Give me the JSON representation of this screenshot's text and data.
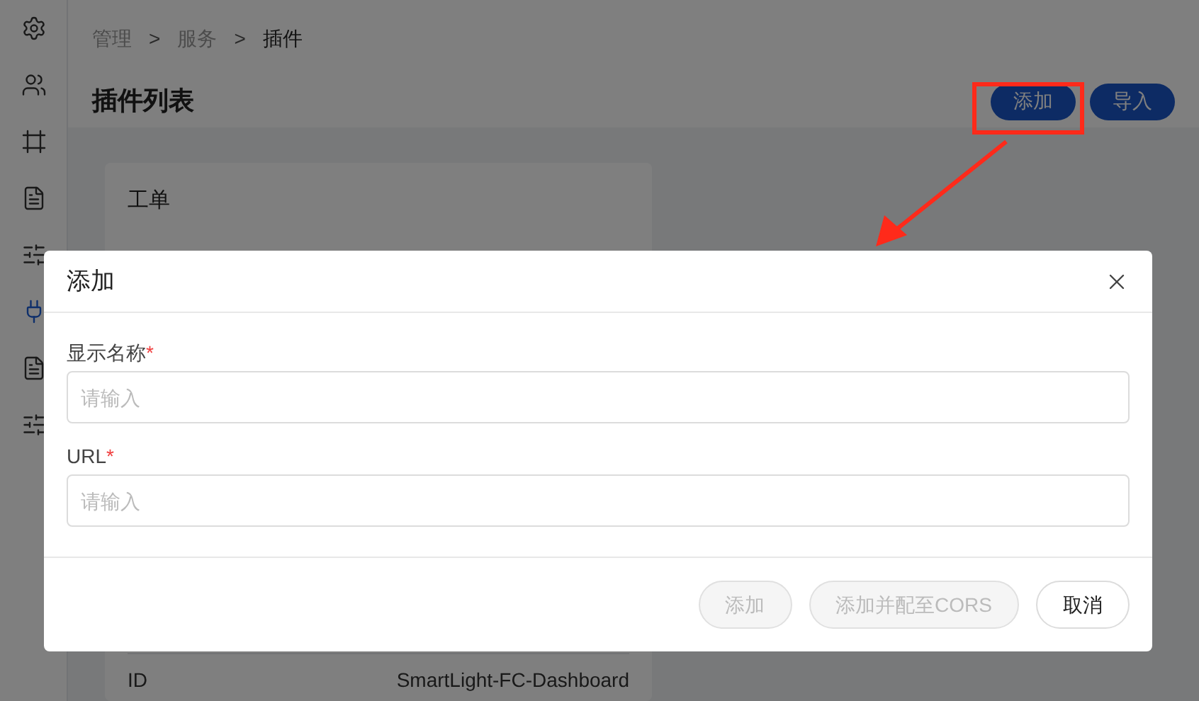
{
  "sidebar": {
    "items": [
      {
        "selected": false
      },
      {
        "selected": false
      },
      {
        "selected": false
      },
      {
        "selected": false
      },
      {
        "selected": false
      },
      {
        "selected": true
      },
      {
        "selected": false
      },
      {
        "selected": false
      }
    ]
  },
  "breadcrumb": [
    {
      "label": "管理",
      "current": false
    },
    {
      "label": "服务",
      "current": false
    },
    {
      "label": "插件",
      "current": true
    }
  ],
  "breadcrumb_separator": ">",
  "page_title": "插件列表",
  "header_buttons": [
    "添加",
    "导入"
  ],
  "card": {
    "title": "工单",
    "rows": [
      {
        "label": "ID",
        "value": "SmartLight-FC-Dashboard"
      }
    ]
  },
  "dialog": {
    "title": "添加",
    "required_mark": "*",
    "fields": [
      {
        "label": "显示名称",
        "required": true,
        "placeholder": "请输入"
      },
      {
        "label": "URL",
        "required": true,
        "placeholder": "请输入"
      }
    ],
    "buttons": [
      {
        "label": "添加",
        "disabled": true
      },
      {
        "label": "添加并配至CORS",
        "disabled": true
      },
      {
        "label": "取消",
        "disabled": false
      }
    ]
  }
}
